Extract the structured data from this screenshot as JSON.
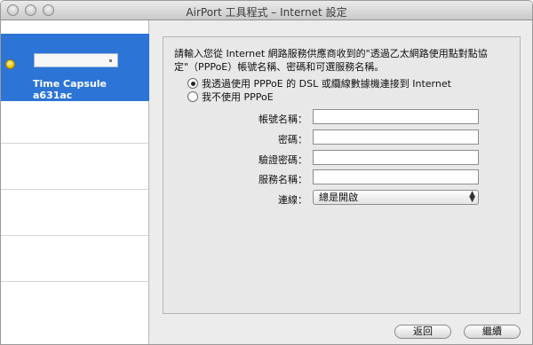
{
  "window": {
    "title": "AirPort 工具程式 – Internet 設定"
  },
  "sidebar": {
    "selected_device_name": "Time Capsule a631ac"
  },
  "panel": {
    "instruction": "請輸入您從 Internet 網路服務供應商收到的\"透過乙太網路使用點對點協定\"（PPPoE）帳號名稱、密碼和可選服務名稱。",
    "radio_options": [
      {
        "label": "我透過使用 PPPoE 的 DSL 或纜線數據機連接到 Internet",
        "checked": true
      },
      {
        "label": "我不使用 PPPoE",
        "checked": false
      }
    ],
    "fields": [
      {
        "label": "帳號名稱：",
        "value": ""
      },
      {
        "label": "密碼：",
        "value": ""
      },
      {
        "label": "驗證密碼：",
        "value": ""
      },
      {
        "label": "服務名稱：",
        "value": ""
      }
    ],
    "connection": {
      "label": "連線：",
      "value": "總是開啟"
    }
  },
  "buttons": {
    "back": "返回",
    "continue": "繼續"
  },
  "colors": {
    "selection": "#2c74d6",
    "panel_bg": "#e8e8e8"
  },
  "icons": {
    "status": "status-light-icon",
    "popup_arrows": "up-down-arrows-icon"
  }
}
